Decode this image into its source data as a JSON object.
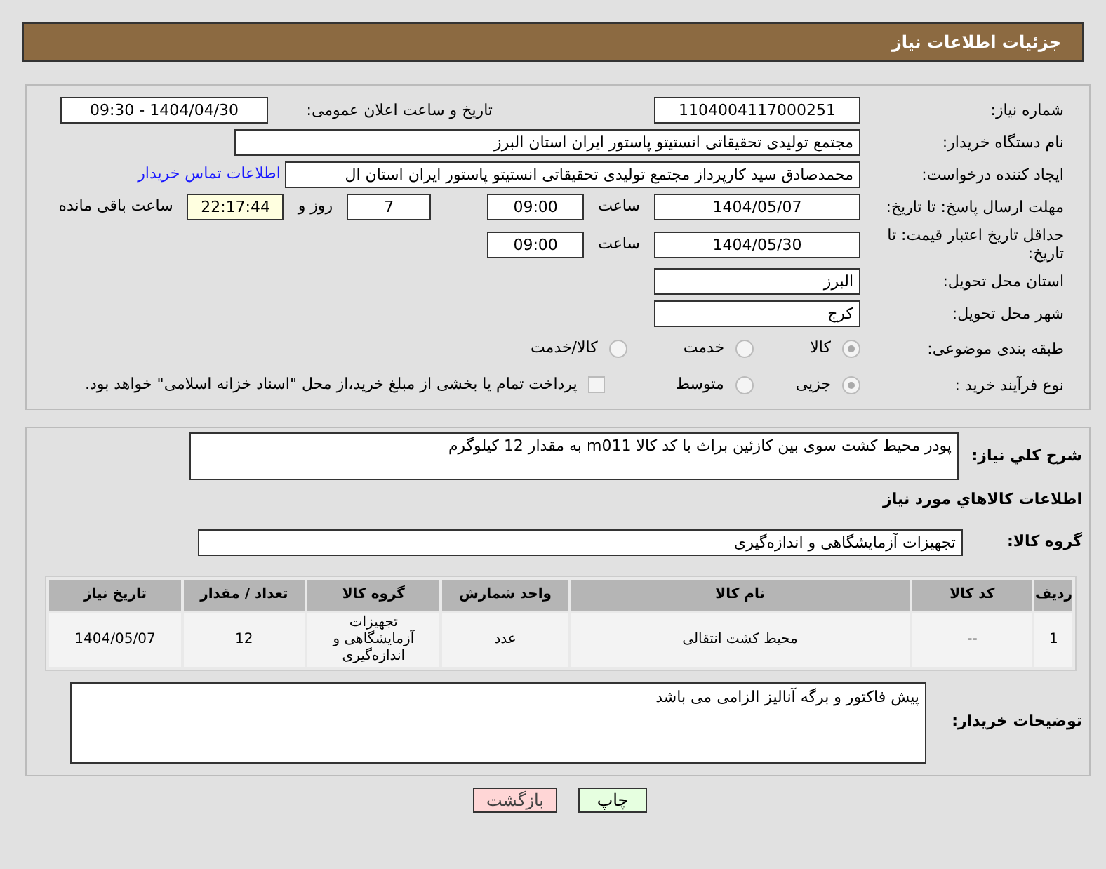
{
  "header": {
    "title": "جزئیات اطلاعات نیاز"
  },
  "need_number": {
    "label": "شماره نیاز:",
    "value": "1104004117000251"
  },
  "announce": {
    "label": "تاریخ و ساعت اعلان عمومی:",
    "value": "1404/04/30 - 09:30"
  },
  "buyer_org": {
    "label": "نام دستگاه خریدار:",
    "value": "مجتمع تولیدی تحقیقاتی انستیتو پاستور ایران استان البرز"
  },
  "requester": {
    "label": "ایجاد کننده درخواست:",
    "value": "محمدصادق سید کارپرداز مجتمع تولیدی تحقیقاتی انستیتو پاستور ایران استان ال",
    "link": "اطلاعات تماس خریدار"
  },
  "reply_deadline": {
    "label": "مهلت ارسال پاسخ: تا تاریخ:",
    "date": "1404/05/07",
    "time_label": "ساعت",
    "time": "09:00",
    "days": "7",
    "days_label": "روز و",
    "remaining": "22:17:44",
    "remaining_label": "ساعت باقی مانده"
  },
  "price_validity": {
    "label": "حداقل تاریخ اعتبار قیمت: تا تاریخ:",
    "date": "1404/05/30",
    "time_label": "ساعت",
    "time": "09:00"
  },
  "province": {
    "label": "استان محل تحویل:",
    "value": "البرز"
  },
  "city": {
    "label": "شهر محل تحویل:",
    "value": "کرج"
  },
  "category": {
    "label": "طبقه بندی موضوعی:",
    "options": [
      {
        "label": "کالا",
        "selected": true
      },
      {
        "label": "خدمت",
        "selected": false
      },
      {
        "label": "کالا/خدمت",
        "selected": false
      }
    ]
  },
  "purchase_type": {
    "label": "نوع فرآیند خرید :",
    "options": [
      {
        "label": "جزیی",
        "selected": true
      },
      {
        "label": "متوسط",
        "selected": false
      }
    ],
    "payment_checkbox": {
      "label": "پرداخت تمام یا بخشی از مبلغ خرید،از محل \"اسناد خزانه اسلامی\" خواهد بود.",
      "checked": false
    }
  },
  "description": {
    "label": "شرح کلي نياز:",
    "value": "پودر محیط کشت سوی بین کازئین براث با کد کالا m011 به مقدار 12 کیلوگرم"
  },
  "goods_section": {
    "title": "اطلاعات کالاهاي مورد نياز"
  },
  "goods_group": {
    "label": "گروه کالا:",
    "value": "تجهیزات آزمایشگاهی و اندازه‌گیری"
  },
  "table": {
    "columns": [
      "ردیف",
      "کد کالا",
      "نام کالا",
      "واحد شمارش",
      "گروه کالا",
      "تعداد / مقدار",
      "تاریخ نیاز"
    ],
    "rows": [
      [
        "1",
        "--",
        "محیط کشت انتقالی",
        "عدد",
        "تجهیزات آزمایشگاهی و اندازه‌گیری",
        "12",
        "1404/05/07"
      ]
    ]
  },
  "buyer_notes": {
    "label": "توضیحات خریدار:",
    "value": "پیش فاکتور و برگه آنالیز الزامی می باشد"
  },
  "buttons": [
    {
      "kind": "print",
      "label": "چاپ"
    },
    {
      "kind": "back",
      "label": "بازگشت"
    }
  ]
}
